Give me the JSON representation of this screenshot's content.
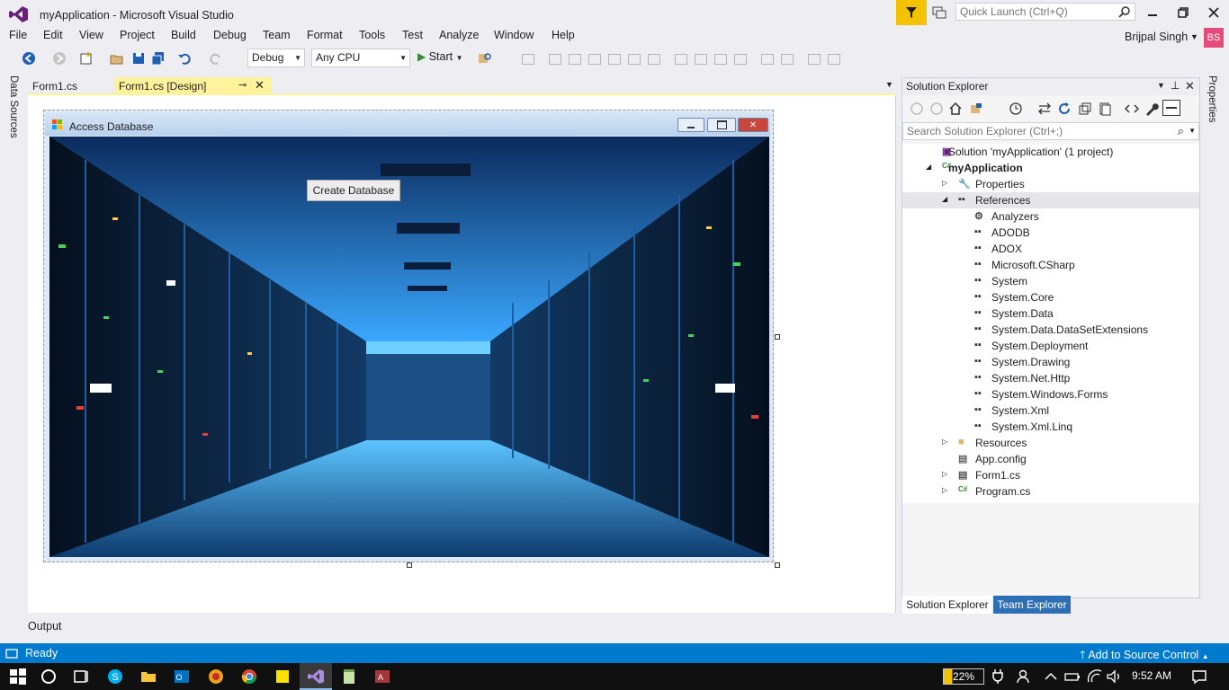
{
  "window": {
    "title": "myApplication - Microsoft Visual Studio",
    "quick_launch_placeholder": "Quick Launch (Ctrl+Q)",
    "user": "Brijpal Singh",
    "avatar_initials": "BS"
  },
  "menu": [
    "File",
    "Edit",
    "View",
    "Project",
    "Build",
    "Debug",
    "Team",
    "Format",
    "Tools",
    "Test",
    "Analyze",
    "Window",
    "Help"
  ],
  "toolbar": {
    "config": "Debug",
    "platform": "Any CPU",
    "start_label": "Start"
  },
  "left_strip": {
    "data_sources": "Data Sources"
  },
  "doc_tabs": {
    "form1cs": "Form1.cs",
    "form1cs_design": "Form1.cs [Design]"
  },
  "form": {
    "title": "Access Database",
    "button_label": "Create Database"
  },
  "solution_explorer": {
    "title": "Solution Explorer",
    "search_placeholder": "Search Solution Explorer (Ctrl+;)",
    "tree": [
      {
        "label": "Solution 'myApplication' (1 project)",
        "level": 0,
        "arrow": "",
        "icon": "solution-icon",
        "bold": false
      },
      {
        "label": "myApplication",
        "level": 0,
        "arrow": "expanded",
        "icon": "csharp-project-icon",
        "bold": true
      },
      {
        "label": "Properties",
        "level": 1,
        "arrow": "collapsed",
        "icon": "wrench-icon",
        "bold": false
      },
      {
        "label": "References",
        "level": 1,
        "arrow": "expanded",
        "icon": "references-icon",
        "bold": false,
        "selected": true
      },
      {
        "label": "Analyzers",
        "level": 2,
        "arrow": "",
        "icon": "analyzers-icon",
        "bold": false
      },
      {
        "label": "ADODB",
        "level": 2,
        "arrow": "",
        "icon": "reference-icon",
        "bold": false
      },
      {
        "label": "ADOX",
        "level": 2,
        "arrow": "",
        "icon": "reference-icon",
        "bold": false
      },
      {
        "label": "Microsoft.CSharp",
        "level": 2,
        "arrow": "",
        "icon": "reference-icon",
        "bold": false
      },
      {
        "label": "System",
        "level": 2,
        "arrow": "",
        "icon": "reference-icon",
        "bold": false
      },
      {
        "label": "System.Core",
        "level": 2,
        "arrow": "",
        "icon": "reference-icon",
        "bold": false
      },
      {
        "label": "System.Data",
        "level": 2,
        "arrow": "",
        "icon": "reference-icon",
        "bold": false
      },
      {
        "label": "System.Data.DataSetExtensions",
        "level": 2,
        "arrow": "",
        "icon": "reference-icon",
        "bold": false
      },
      {
        "label": "System.Deployment",
        "level": 2,
        "arrow": "",
        "icon": "reference-icon",
        "bold": false
      },
      {
        "label": "System.Drawing",
        "level": 2,
        "arrow": "",
        "icon": "reference-icon",
        "bold": false
      },
      {
        "label": "System.Net.Http",
        "level": 2,
        "arrow": "",
        "icon": "reference-icon",
        "bold": false
      },
      {
        "label": "System.Windows.Forms",
        "level": 2,
        "arrow": "",
        "icon": "reference-icon",
        "bold": false
      },
      {
        "label": "System.Xml",
        "level": 2,
        "arrow": "",
        "icon": "reference-icon",
        "bold": false
      },
      {
        "label": "System.Xml.Linq",
        "level": 2,
        "arrow": "",
        "icon": "reference-icon",
        "bold": false
      },
      {
        "label": "Resources",
        "level": 1,
        "arrow": "collapsed",
        "icon": "folder-icon",
        "bold": false
      },
      {
        "label": "App.config",
        "level": 1,
        "arrow": "",
        "icon": "config-file-icon",
        "bold": false
      },
      {
        "label": "Form1.cs",
        "level": 1,
        "arrow": "collapsed",
        "icon": "form-file-icon",
        "bold": false
      },
      {
        "label": "Program.cs",
        "level": 1,
        "arrow": "collapsed",
        "icon": "csharp-file-icon",
        "bold": false
      }
    ],
    "tabs": {
      "solution_explorer": "Solution Explorer",
      "team_explorer": "Team Explorer"
    }
  },
  "right_strip": {
    "properties": "Properties"
  },
  "output_tab": "Output",
  "status": {
    "text": "Ready",
    "source_control": "Add to Source Control"
  },
  "taskbar": {
    "battery": "22%",
    "battery_level": 0.22,
    "clock": "9:52 AM"
  },
  "colors": {
    "accent": "#007acc",
    "tab_active": "#fff29d",
    "filter": "#f5c200",
    "avatar": "#e44b7b"
  }
}
